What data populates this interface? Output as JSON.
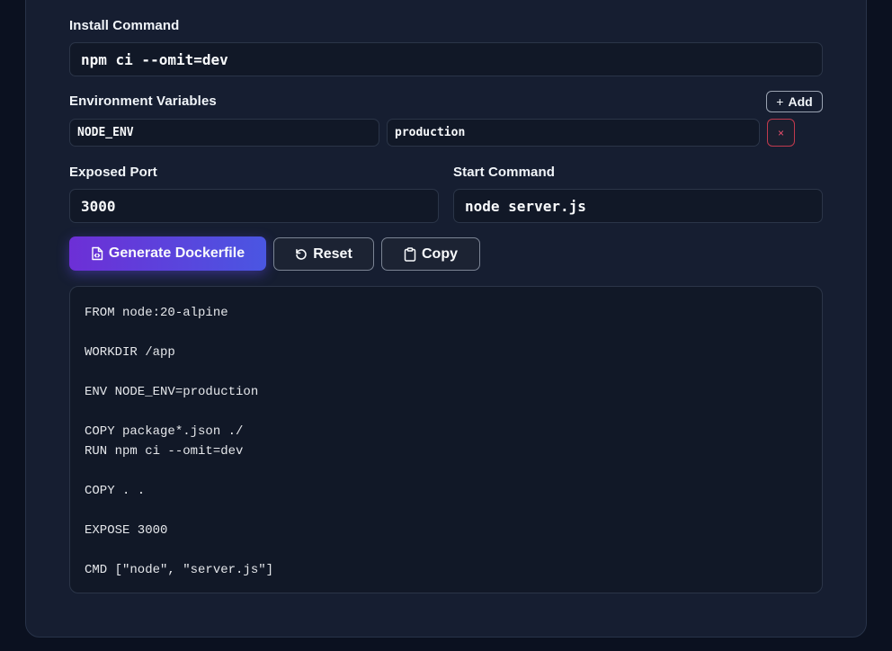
{
  "install": {
    "label": "Install Command",
    "value": "npm ci --omit=dev"
  },
  "env": {
    "label": "Environment Variables",
    "add_label": "Add",
    "add_icon": "plus-icon",
    "remove_icon": "close-icon",
    "remove_glyph": "×",
    "rows": [
      {
        "key": "NODE_ENV",
        "value": "production"
      }
    ]
  },
  "port": {
    "label": "Exposed Port",
    "value": "3000"
  },
  "start": {
    "label": "Start Command",
    "value": "node server.js"
  },
  "actions": {
    "generate_label": "Generate Dockerfile",
    "generate_icon": "file-code-icon",
    "reset_label": "Reset",
    "reset_icon": "rotate-ccw-icon",
    "copy_label": "Copy",
    "copy_icon": "clipboard-icon"
  },
  "output": {
    "dockerfile": "FROM node:20-alpine\n\nWORKDIR /app\n\nENV NODE_ENV=production\n\nCOPY package*.json ./\nRUN npm ci --omit=dev\n\nCOPY . .\n\nEXPOSE 3000\n\nCMD [\"node\", \"server.js\"]"
  },
  "colors": {
    "background": "#0b1120",
    "card": "#161e31",
    "input": "#111827",
    "accent_start": "#6d2fd6",
    "accent_end": "#4a56e2",
    "danger": "#f0506e"
  }
}
